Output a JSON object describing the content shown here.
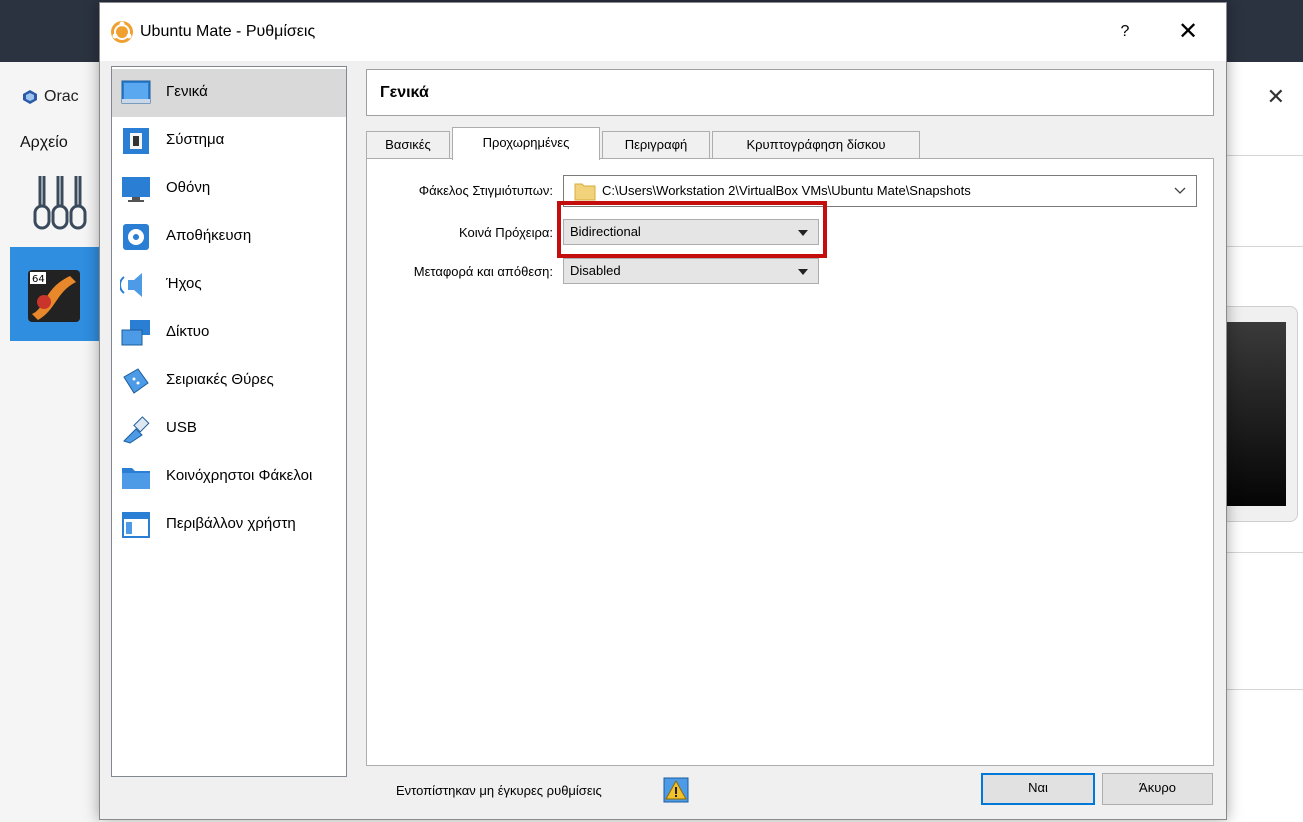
{
  "background": {
    "app_title": "Orac",
    "menu_file": "Αρχείο"
  },
  "dialog": {
    "title": "Ubuntu Mate - Ρυθμίσεις",
    "help": "?",
    "close": "✕"
  },
  "sidebar": {
    "items": [
      {
        "label": "Γενικά",
        "icon": "general-icon",
        "selected": true
      },
      {
        "label": "Σύστημα",
        "icon": "system-chip-icon"
      },
      {
        "label": "Οθόνη",
        "icon": "monitor-icon"
      },
      {
        "label": "Αποθήκευση",
        "icon": "storage-disk-icon"
      },
      {
        "label": "Ήχος",
        "icon": "speaker-icon"
      },
      {
        "label": "Δίκτυο",
        "icon": "network-icon"
      },
      {
        "label": "Σειριακές Θύρες",
        "icon": "serial-port-icon"
      },
      {
        "label": "USB",
        "icon": "usb-icon"
      },
      {
        "label": "Κοινόχρηστοι Φάκελοι",
        "icon": "shared-folder-icon"
      },
      {
        "label": "Περιβάλλον χρήστη",
        "icon": "user-interface-icon"
      }
    ]
  },
  "page": {
    "header": "Γενικά",
    "tabs": [
      {
        "label": "Βασικές"
      },
      {
        "label": "Προχωρημένες",
        "active": true
      },
      {
        "label": "Περιγραφή"
      },
      {
        "label": "Κρυπτογράφηση δίσκου"
      }
    ],
    "snapshot_label": "Φάκελος Στιγμιότυπων:",
    "snapshot_path": "C:\\Users\\Workstation 2\\VirtualBox VMs\\Ubuntu Mate\\Snapshots",
    "clipboard_label": "Κοινά Πρόχειρα:",
    "clipboard_value": "Bidirectional",
    "dragdrop_label": "Μεταφορά και απόθεση:",
    "dragdrop_value": "Disabled"
  },
  "footer": {
    "status": "Εντοπίστηκαν μη έγκυρες ρυθμίσεις",
    "ok": "Ναι",
    "cancel": "Άκυρο"
  },
  "colors": {
    "highlight": "#c40d0d",
    "selection": "#d9d9d9",
    "accent": "#0078d7"
  }
}
